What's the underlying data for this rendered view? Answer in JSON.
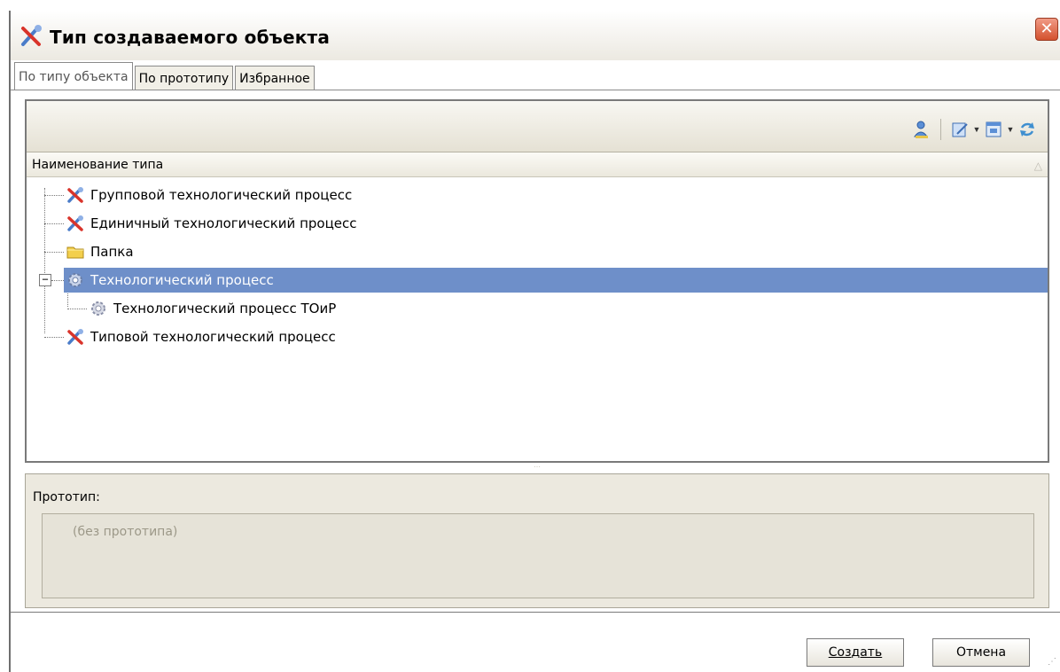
{
  "window": {
    "title": "Тип создаваемого объекта",
    "title_icon": "tools-icon",
    "close_label": "✕"
  },
  "tabs": [
    {
      "label": "По типу объекта",
      "active": true
    },
    {
      "label": "По прототипу",
      "active": false
    },
    {
      "label": "Избранное",
      "active": false
    }
  ],
  "toolbar": {
    "icons": [
      "user-icon",
      "edit-icon",
      "view-icon",
      "refresh-icon"
    ]
  },
  "tree": {
    "column_header": "Наименование типа",
    "items": [
      {
        "label": "Групповой технологический процесс",
        "icon": "tools-icon",
        "level": 0,
        "selected": false
      },
      {
        "label": "Единичный технологический процесс",
        "icon": "tools-icon",
        "level": 0,
        "selected": false
      },
      {
        "label": "Папка",
        "icon": "folder-icon",
        "level": 0,
        "selected": false
      },
      {
        "label": "Технологический процесс",
        "icon": "gear-icon",
        "level": 0,
        "selected": true,
        "expanded": true
      },
      {
        "label": "Технологический процесс ТОиР",
        "icon": "gear-icon",
        "level": 1,
        "selected": false
      },
      {
        "label": "Типовой технологический процесс",
        "icon": "tools-icon",
        "level": 0,
        "selected": false
      }
    ],
    "expander_symbol": "−"
  },
  "prototype": {
    "label": "Прототип:",
    "value": "(без прототипа)"
  },
  "buttons": {
    "create": "Создать",
    "cancel": "Отмена"
  },
  "colors": {
    "selection": "#6e8fc9",
    "close_button": "#d3512e"
  }
}
